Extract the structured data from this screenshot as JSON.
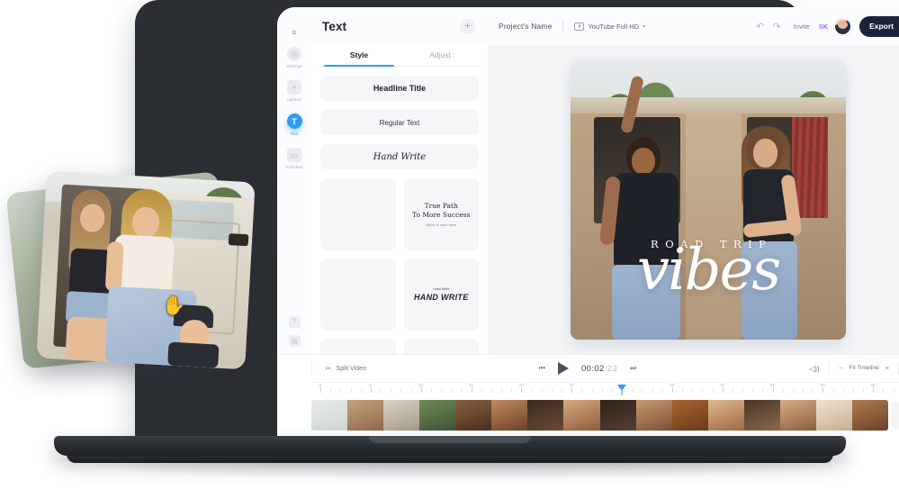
{
  "app": {
    "panel_title": "Text",
    "add_button": "+"
  },
  "topbar": {
    "project_name": "Project's Name",
    "ratio_label": "YouTube Full HD",
    "caret": "▾",
    "undo_icon": "↶",
    "redo_icon": "↷",
    "invite_label": "Invite",
    "user_initials": "SK",
    "export_label": "Export",
    "export_icon": "⤴"
  },
  "rail": {
    "menu_icon": "≡",
    "items": [
      {
        "label": "Settings",
        "icon": "◎",
        "active": false
      },
      {
        "label": "Upload",
        "icon": "+",
        "active": false
      },
      {
        "label": "Text",
        "icon": "T",
        "active": true
      },
      {
        "label": "Subtitles",
        "icon": "▭",
        "active": false
      }
    ],
    "bottom": [
      {
        "name": "help-icon",
        "icon": "?"
      },
      {
        "name": "layers-icon",
        "icon": "▤"
      }
    ]
  },
  "panel": {
    "tabs": [
      {
        "label": "Style",
        "active": true
      },
      {
        "label": "Adjust",
        "active": false
      }
    ],
    "style_buttons": [
      {
        "label": "Headline Title"
      },
      {
        "label": "Regular Text"
      },
      {
        "label": "Hand Write"
      }
    ],
    "templates": [
      {
        "line1": "True Path",
        "line2": "To More Success",
        "sub": "Watch to learn more"
      },
      {
        "script": "Hand Write",
        "display": "HAND WRITE"
      }
    ]
  },
  "canvas": {
    "overlay_title": "ROAD TRIP",
    "overlay_script": "vibes"
  },
  "timeline": {
    "split_label": "Split Video",
    "split_icon": "✂",
    "prev_icon": "⏮",
    "play_icon": "▶",
    "next_icon": "⏭",
    "timecode_main": "00:02",
    "timecode_ms": ":23",
    "volume_icon": "🔊",
    "zoom_out": "−",
    "zoom_label": "Fit Timeline",
    "zoom_in": "+",
    "waveform_icon": "∿",
    "add_clip": "+",
    "ruler_ticks": [
      "0",
      "5",
      "10",
      "15",
      "20",
      "25",
      "30",
      "35",
      "40",
      "45",
      "50",
      "55"
    ],
    "playhead_position_pct": 50
  },
  "colors": {
    "accent": "#2f9bf5",
    "export_bg": "#1b2338",
    "panel_bg": "#f5f6f8",
    "stage_bg": "#f2f4f6"
  }
}
